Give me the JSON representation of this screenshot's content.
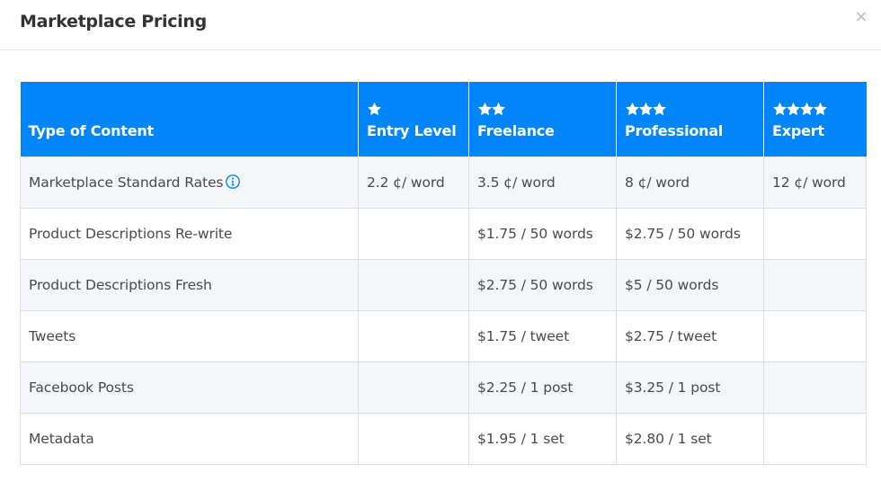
{
  "modal": {
    "title": "Marketplace Pricing",
    "close_label": "×"
  },
  "colors": {
    "header_bg": "#0285f9",
    "info_icon": "#0285f9",
    "row_stripe": "#f4f6f9"
  },
  "table": {
    "columns": [
      {
        "label": "Type of Content",
        "stars": 0
      },
      {
        "label": "Entry Level",
        "stars": 1
      },
      {
        "label": "Freelance",
        "stars": 2
      },
      {
        "label": "Professional",
        "stars": 3
      },
      {
        "label": "Expert",
        "stars": 4
      }
    ],
    "rows": [
      {
        "type": "Marketplace Standard Rates",
        "info_icon": "info-circle-icon",
        "entry": "2.2 ¢/ word",
        "freelance": "3.5 ¢/ word",
        "professional": "8 ¢/ word",
        "expert": "12 ¢/ word"
      },
      {
        "type": "Product Descriptions Re-write",
        "entry": "",
        "freelance": "$1.75 / 50 words",
        "professional": "$2.75 / 50 words",
        "expert": ""
      },
      {
        "type": "Product Descriptions Fresh",
        "entry": "",
        "freelance": "$2.75 / 50 words",
        "professional": "$5 / 50 words",
        "expert": ""
      },
      {
        "type": "Tweets",
        "entry": "",
        "freelance": "$1.75 / tweet",
        "professional": "$2.75 / tweet",
        "expert": ""
      },
      {
        "type": "Facebook Posts",
        "entry": "",
        "freelance": "$2.25 / 1 post",
        "professional": "$3.25 / 1 post",
        "expert": ""
      },
      {
        "type": "Metadata",
        "entry": "",
        "freelance": "$1.95 / 1 set",
        "professional": "$2.80 / 1 set",
        "expert": ""
      }
    ]
  }
}
